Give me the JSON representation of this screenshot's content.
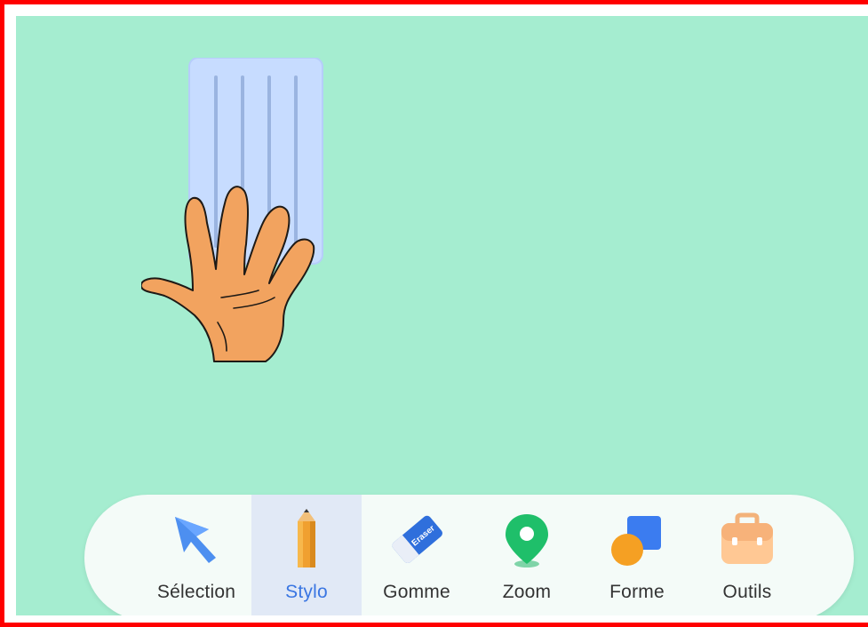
{
  "toolbar": {
    "active_tool": "Stylo",
    "tools": [
      {
        "label": "Sélection",
        "icon": "cursor-arrow-icon"
      },
      {
        "label": "Stylo",
        "icon": "pencil-icon"
      },
      {
        "label": "Gomme",
        "icon": "eraser-icon"
      },
      {
        "label": "Zoom",
        "icon": "map-pin-icon"
      },
      {
        "label": "Forme",
        "icon": "shapes-icon"
      },
      {
        "label": "Outils",
        "icon": "toolbox-icon"
      }
    ]
  },
  "eraser_icon_text": "Eraser",
  "colors": {
    "canvas_background": "#a5edd0",
    "frame_border": "#ff0000",
    "active_label": "#3a76e2",
    "active_tool_background": "#e1e9f6"
  }
}
